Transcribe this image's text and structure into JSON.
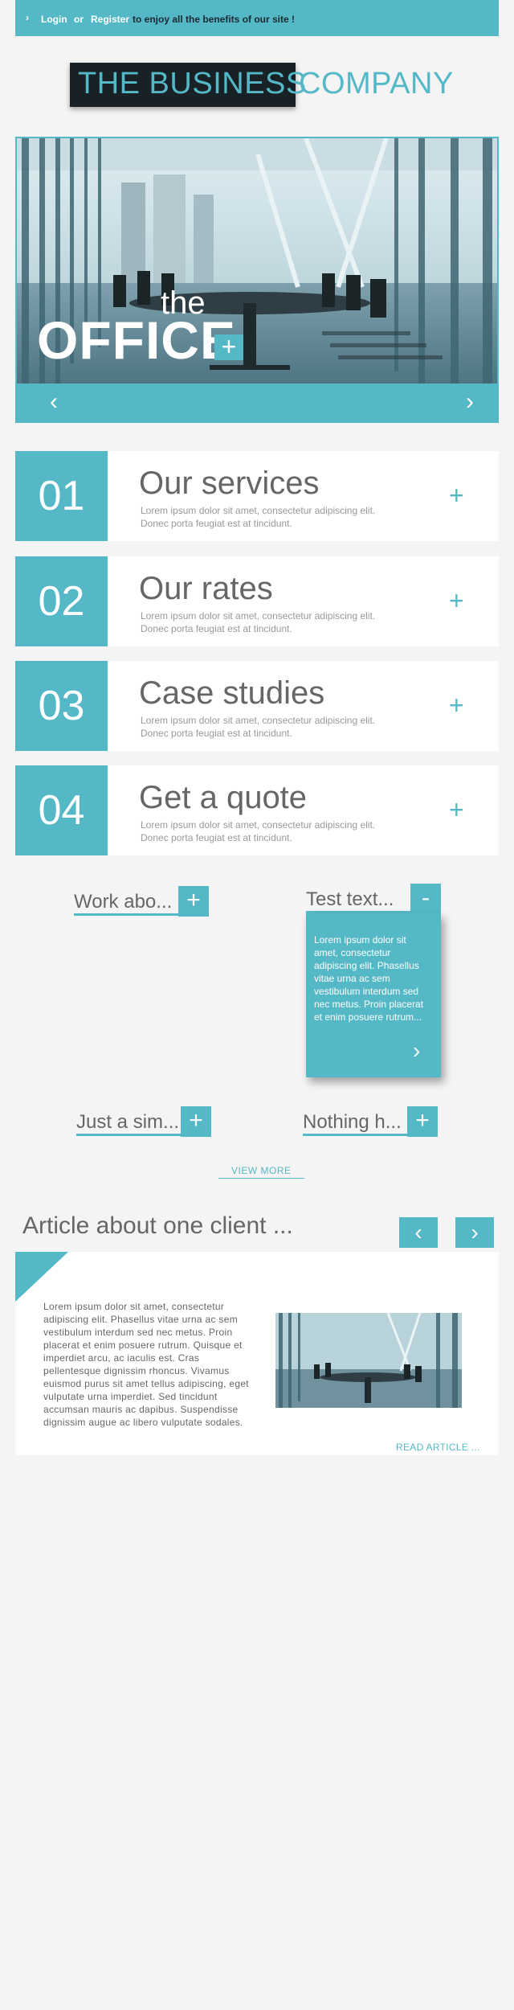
{
  "topbar": {
    "chevron": "›",
    "login": "Login",
    "or": "or",
    "register": "Register",
    "rest": "to enjoy all the benefits of our site !"
  },
  "logo": {
    "part1": "THE BUSINESS",
    "part2": "COMPANY"
  },
  "hero": {
    "the": "the",
    "office": "OFFICE",
    "plus": "+",
    "prev": "‹",
    "next": "›"
  },
  "services": [
    {
      "num": "01",
      "title": "Our services",
      "desc": "Lorem ipsum dolor sit amet, consectetur adipiscing elit. Donec porta feugiat est at tincidunt.",
      "plus": "+"
    },
    {
      "num": "02",
      "title": "Our rates",
      "desc": "Lorem ipsum dolor sit amet, consectetur adipiscing elit. Donec porta feugiat est at tincidunt.",
      "plus": "+"
    },
    {
      "num": "03",
      "title": "Case studies",
      "desc": "Lorem ipsum dolor sit amet, consectetur adipiscing elit. Donec porta feugiat est at tincidunt.",
      "plus": "+"
    },
    {
      "num": "04",
      "title": "Get a quote",
      "desc": "Lorem ipsum dolor sit amet, consectetur adipiscing elit. Donec porta feugiat est at tincidunt.",
      "plus": "+"
    }
  ],
  "accordions": [
    {
      "label": "Work abo...",
      "btn": "+"
    },
    {
      "label": "Test text...",
      "btn": "-"
    },
    {
      "label": "Just a sim...",
      "btn": "+"
    },
    {
      "label": "Nothing h...",
      "btn": "+"
    }
  ],
  "popup": {
    "text": "Lorem ipsum dolor sit amet, consectetur adipiscing elit. Phasellus vitae urna ac sem vestibulum interdum sed nec metus. Proin placerat et enim posuere rutrum...",
    "next": "›"
  },
  "view_more": "VIEW MORE",
  "article": {
    "title": "Article about one client ...",
    "prev": "‹",
    "next": "›",
    "body": "Lorem ipsum dolor sit amet, consectetur adipiscing elit. Phasellus vitae urna ac sem vestibulum interdum sed nec metus. Proin placerat et enim posuere rutrum. Quisque et imperdiet arcu, ac iaculis est. Cras pellentesque dignissim rhoncus. Vivamus euismod purus sit amet tellus adipiscing, eget vulputate urna imperdiet. Sed tincidunt accumsan mauris ac dapibus. Suspendisse dignissim augue ac libero vulputate sodales.",
    "read": "READ ARTICLE ..."
  },
  "colors": {
    "accent": "#55b8c6",
    "dark": "#182126",
    "page_bg": "#f4f4f4"
  }
}
